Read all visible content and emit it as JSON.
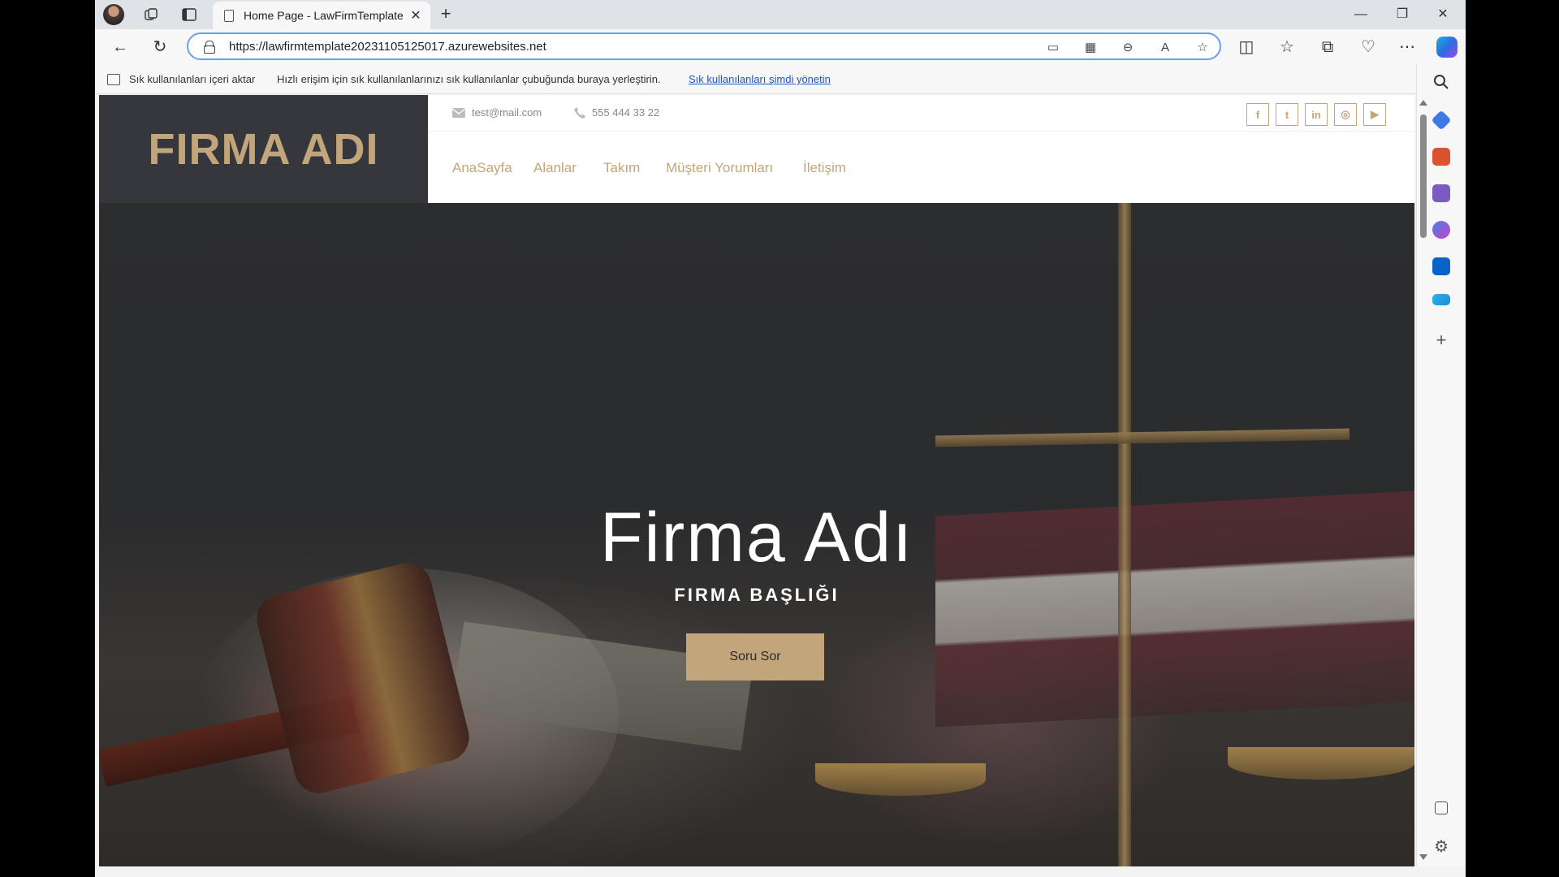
{
  "browser": {
    "tab_title": "Home Page - LawFirmTemplate",
    "url": "https://lawfirmtemplate20231105125017.azurewebsites.net",
    "favorites_bar": {
      "import_label": "Sık kullanılanları içeri aktar",
      "message": "Hızlı erişim için sık kullanılanlarınızı sık kullanılanlar çubuğunda buraya yerleştirin.",
      "manage_link": "Sık kullanılanları şimdi yönetin"
    }
  },
  "site": {
    "logo": "FIRMA ADI",
    "contact": {
      "email": "test@mail.com",
      "phone": "555 444 33 22"
    },
    "social_icons": [
      "facebook-icon",
      "twitter-icon",
      "linkedin-icon",
      "instagram-icon",
      "youtube-icon"
    ],
    "nav": [
      "AnaSayfa",
      "Alanlar",
      "Takım",
      "Müşteri Yorumları",
      "İletişim"
    ],
    "hero": {
      "title": "Firma Adı",
      "subtitle": "FIRMA BAŞLIĞI",
      "button": "Soru Sor"
    },
    "accent_color": "#c2a57a"
  }
}
